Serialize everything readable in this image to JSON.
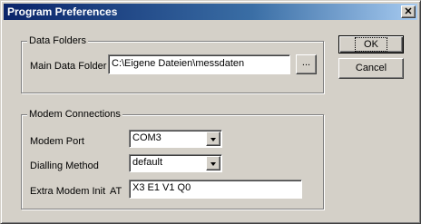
{
  "window": {
    "title": "Program Preferences",
    "close_label": "✕"
  },
  "data_folders": {
    "group_label": "Data Folders",
    "main_folder_label": "Main Data Folder",
    "main_folder_value": "C:\\Eigene Dateien\\messdaten",
    "browse_label": "..."
  },
  "modem": {
    "group_label": "Modem Connections",
    "port_label": "Modem Port",
    "port_value": "COM3",
    "dialling_label": "Dialling Method",
    "dialling_value": "default",
    "init_label": "Extra Modem Init",
    "init_prefix": "AT",
    "init_value": "X3 E1 V1 Q0"
  },
  "buttons": {
    "ok": "OK",
    "cancel": "Cancel"
  },
  "colors": {
    "face": "#d4d0c8",
    "title_start": "#0a246a",
    "title_end": "#a6caf0"
  }
}
